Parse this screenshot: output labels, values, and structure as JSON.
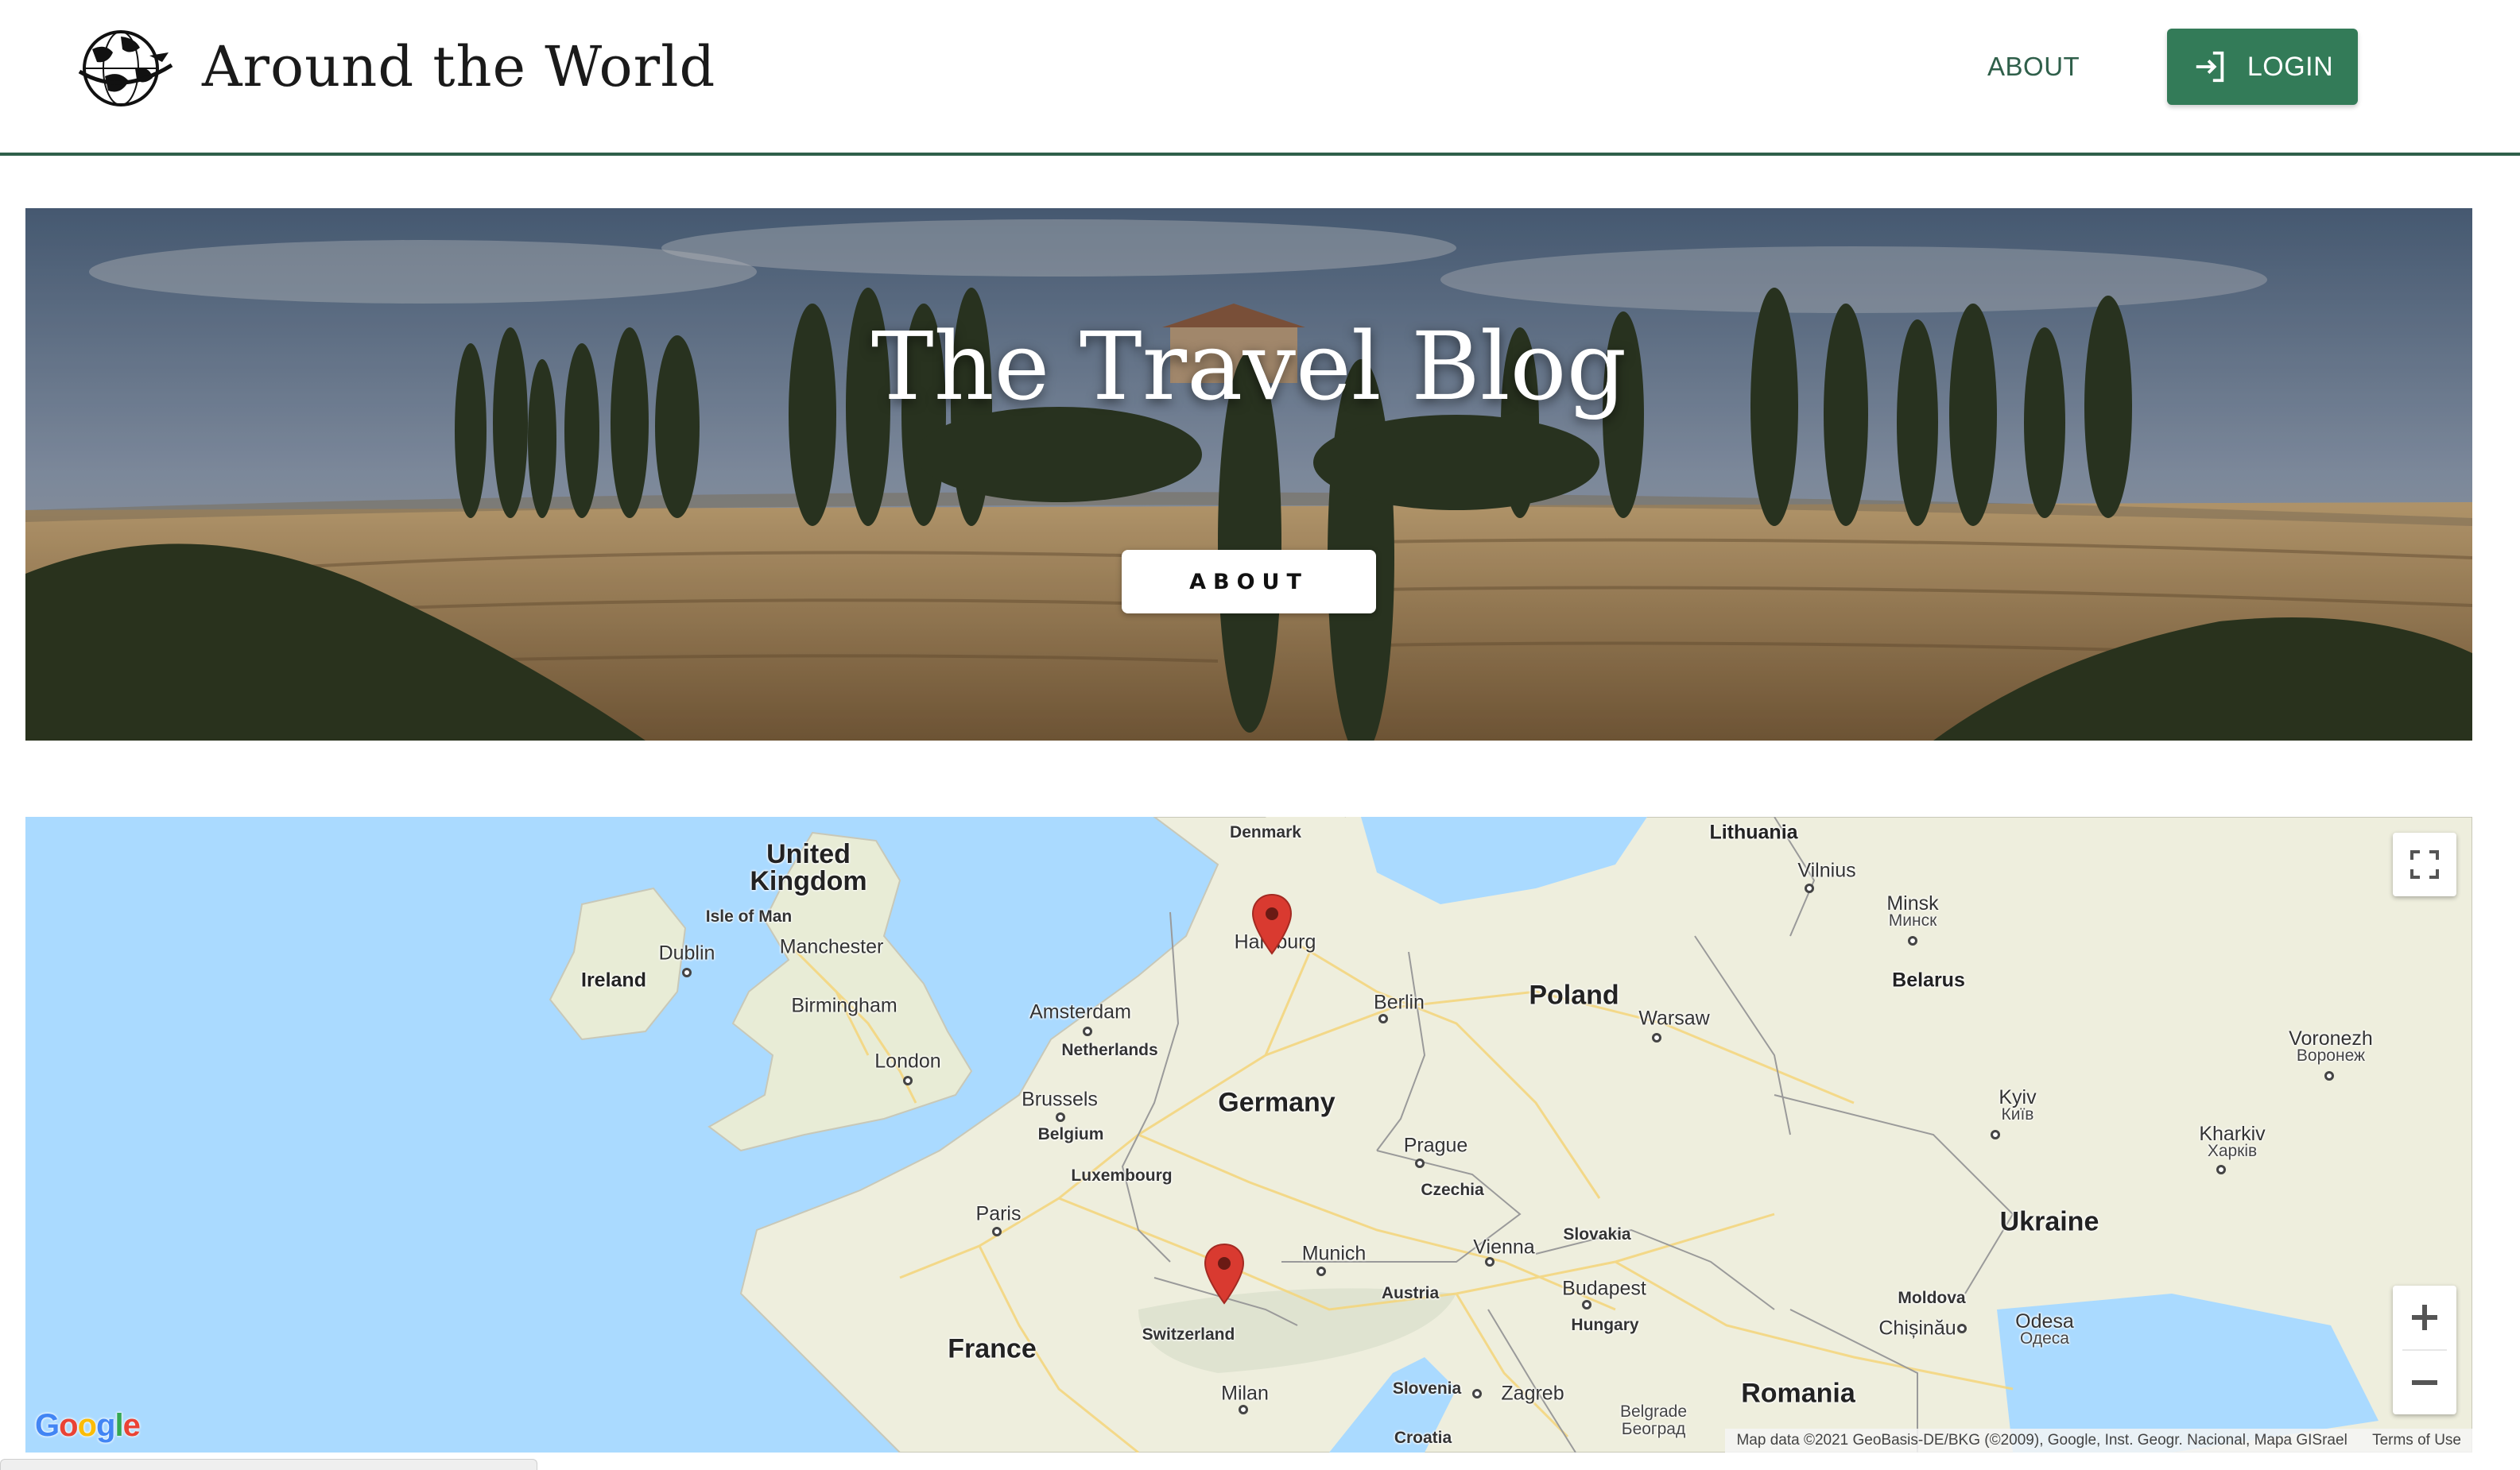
{
  "header": {
    "brand_title": "Around the World",
    "nav_about": "ABOUT",
    "login_label": "LOGIN",
    "accent_color": "#337b58"
  },
  "hero": {
    "title": "The Travel Blog",
    "button_label": "ABOUT"
  },
  "map": {
    "countries": [
      {
        "id": "uk",
        "text": "United\nKingdom"
      },
      {
        "id": "ireland",
        "text": "Ireland"
      },
      {
        "id": "netherlands",
        "text": "Netherlands"
      },
      {
        "id": "belgium",
        "text": "Belgium"
      },
      {
        "id": "luxembourg",
        "text": "Luxembourg"
      },
      {
        "id": "germany",
        "text": "Germany"
      },
      {
        "id": "poland",
        "text": "Poland"
      },
      {
        "id": "czechia",
        "text": "Czechia"
      },
      {
        "id": "slovakia",
        "text": "Slovakia"
      },
      {
        "id": "austria",
        "text": "Austria"
      },
      {
        "id": "hungary",
        "text": "Hungary"
      },
      {
        "id": "switzerland",
        "text": "Switzerland"
      },
      {
        "id": "france",
        "text": "France"
      },
      {
        "id": "slovenia",
        "text": "Slovenia"
      },
      {
        "id": "croatia",
        "text": "Croatia"
      },
      {
        "id": "romania",
        "text": "Romania"
      },
      {
        "id": "ukraine",
        "text": "Ukraine"
      },
      {
        "id": "belarus",
        "text": "Belarus"
      },
      {
        "id": "lithuania",
        "text": "Lithuania"
      },
      {
        "id": "denmark",
        "text": "Denmark"
      },
      {
        "id": "moldova",
        "text": "Moldova"
      },
      {
        "id": "isle-of-man",
        "text": "Isle of Man"
      }
    ],
    "cities": [
      {
        "id": "dublin",
        "text": "Dublin"
      },
      {
        "id": "manchester",
        "text": "Manchester"
      },
      {
        "id": "birmingham",
        "text": "Birmingham"
      },
      {
        "id": "london",
        "text": "London"
      },
      {
        "id": "amsterdam",
        "text": "Amsterdam"
      },
      {
        "id": "brussels",
        "text": "Brussels"
      },
      {
        "id": "paris",
        "text": "Paris"
      },
      {
        "id": "hamburg",
        "text": "Hamburg"
      },
      {
        "id": "berlin",
        "text": "Berlin"
      },
      {
        "id": "warsaw",
        "text": "Warsaw"
      },
      {
        "id": "prague",
        "text": "Prague"
      },
      {
        "id": "munich",
        "text": "Munich"
      },
      {
        "id": "vienna",
        "text": "Vienna"
      },
      {
        "id": "budapest",
        "text": "Budapest"
      },
      {
        "id": "milan",
        "text": "Milan"
      },
      {
        "id": "zagreb",
        "text": "Zagreb"
      },
      {
        "id": "vilnius",
        "text": "Vilnius"
      },
      {
        "id": "chisinau",
        "text": "Chișinău"
      }
    ],
    "bilingual_cities": [
      {
        "id": "minsk",
        "latin": "Minsk",
        "cyrillic": "Минск"
      },
      {
        "id": "kyiv",
        "latin": "Kyiv",
        "cyrillic": "Київ"
      },
      {
        "id": "kharkiv",
        "latin": "Kharkiv",
        "cyrillic": "Харків"
      },
      {
        "id": "voronezh",
        "latin": "Voronezh",
        "cyrillic": "Воронеж"
      },
      {
        "id": "odesa",
        "latin": "Odesa",
        "cyrillic": "Одеса"
      },
      {
        "id": "belgrade",
        "latin": "Belgrade",
        "cyrillic": "Београд"
      }
    ],
    "markers": [
      {
        "id": "hamburg",
        "color": "#d93a30"
      },
      {
        "id": "stuttgart-area",
        "color": "#d93a30"
      }
    ],
    "google_logo": "Google",
    "attribution": "Map data ©2021 GeoBasis-DE/BKG (©2009), Google, Inst. Geogr. Nacional, Mapa GISrael",
    "terms": "Terms of Use",
    "water_color": "#aadaff",
    "land_color": "#eeeedd"
  }
}
